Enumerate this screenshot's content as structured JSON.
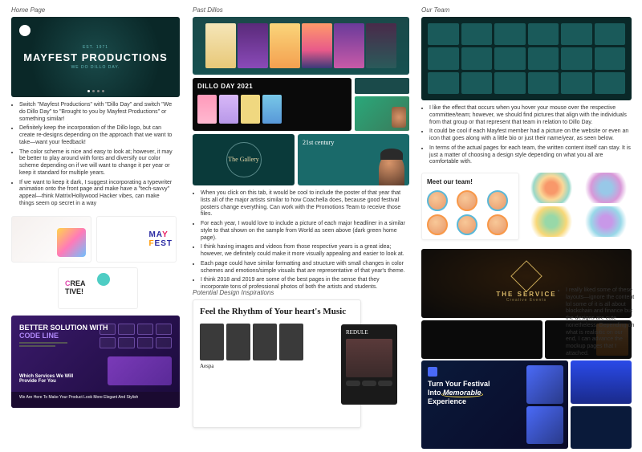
{
  "sections": {
    "home": {
      "heading": "Home Page",
      "hero": {
        "est": "EST. 1971",
        "title": "MAYFEST PRODUCTIONS",
        "sub": "WE DO DILLO DAY."
      },
      "bullets": [
        "Switch \"Mayfest Productions\" with \"Dillo Day\" and switch \"We do Dillo Day\" to \"Brought to you by Mayfest Productions\" or something similar!",
        "Definitely keep the incorporation of the Dillo logo, but can create re-designs depending on the approach that we want to take—want your feedback!",
        "The color scheme is nice and easy to look at; however, it may be better to play around with fonts and diversify our color scheme depending on if we will want to change it per year or keep it standard for multiple years.",
        "If we want to keep it dark, I suggest incorporating a typewriter animation onto the front page and make have a \"tech-savvy\" appeal—think Matrix/Hollywood Hacker vibes, can make things seem op secret in a way"
      ],
      "mayfest_logo": "MAYFEST",
      "creative": "CREA TIVE!",
      "purple": {
        "line1": "BETTER SOLUTION WITH",
        "line2": "CODE LINE",
        "sub": "Which Services We Will Provide For You",
        "footer": "We Are Here To Make Your Product Look More Elegant And Stylish"
      }
    },
    "past": {
      "heading": "Past Dillos",
      "dillo2021": "DILLO DAY 2021",
      "gallery": "The Gallery",
      "century": "21st century",
      "bullets": [
        "When you click on this tab, it would be cool to include the poster of that year that lists all of the major artists similar to how Coachella does, because good festival posters change everything. Can work with the Promotions Team to receive those files.",
        "For each year, I would love to include a picture of each major headliner in a similar style to that shown on the sample from World as seen above (dark green home page).",
        "I think having images and videos from those respective years is a great idea; however, we definitely could make it more visually appealing and easier to look at.",
        "Each page could have similar formatting and structure with small changes in color schemes and emotions/simple visuals that are representative of that year's theme.",
        "I think 2018 and 2019 are some of the best pages in the sense that they incorporate tons of professional photos of both the artists and students."
      ]
    },
    "inspo": {
      "heading": "Potential Design Inspirations",
      "music_title": "Feel the Rhythm of Your heart's Music",
      "aespa": "Aespa",
      "redule": "REDULE"
    },
    "team": {
      "heading": "Our Team",
      "bullets": [
        "I like the effect that occurs when you hover your mouse over the respective committee/team; however, we should find pictures that align with the individuals from that group or that represent that team in relation to Dillo Day.",
        "It could be cool if each Mayfest member had a picture on the website or even an icon that goes along with a little bio or just their name/year, as seen below.",
        "In terms of the actual pages for each team, the written content itself can stay. It is just a matter of choosing a design style depending on what you all are comfortable with."
      ],
      "meet": "Meet our team!",
      "service": {
        "title": "THE SERVICE",
        "sub": "Creative Events"
      },
      "side_note": "I really liked some of these layouts—ignore the content lol some of it is all about blockchain and finance but the designs are cute nonetheless. Depending on what is realisitic on our end, I can advance the mockup pages that I attached.",
      "festival": {
        "line1": "Turn Your Festival",
        "line2a": "Into ",
        "line2b": "Memorable",
        "line3": "Experience"
      }
    }
  }
}
